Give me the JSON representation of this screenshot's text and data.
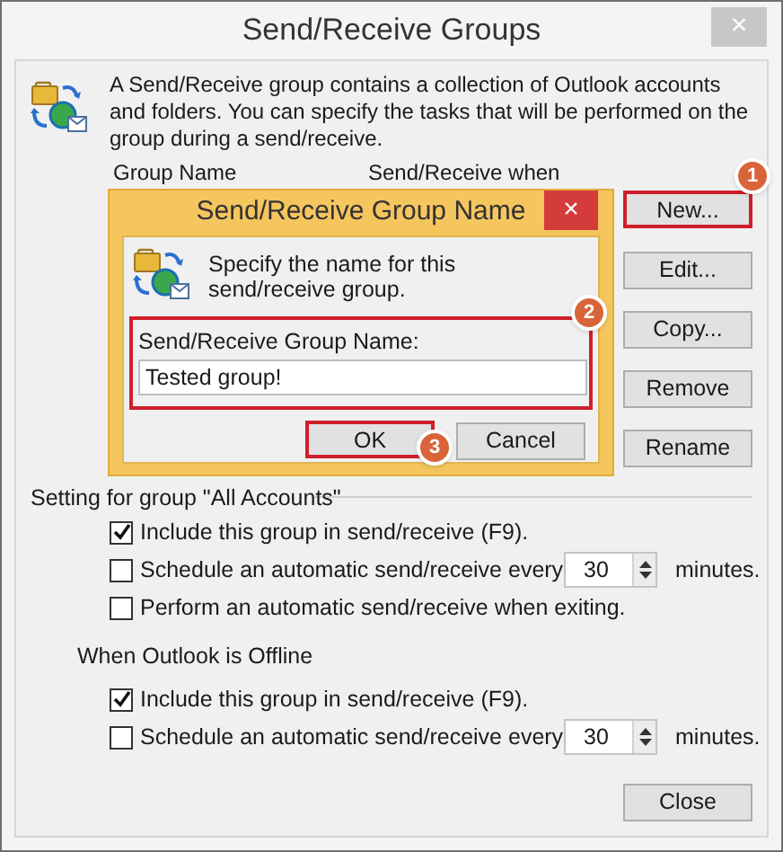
{
  "window": {
    "title": "Send/Receive Groups",
    "close": "×"
  },
  "intro": "A Send/Receive group contains a collection of Outlook accounts and folders. You can specify the tasks that will be performed on the group during a send/receive.",
  "columns": [
    "Group Name",
    "Send/Receive when"
  ],
  "buttons": [
    {
      "label": "New...",
      "highlighted": true,
      "badge": "1"
    },
    {
      "label": "Edit...",
      "highlighted": false
    },
    {
      "label": "Copy...",
      "highlighted": false
    },
    {
      "label": "Remove",
      "highlighted": false
    },
    {
      "label": "Rename",
      "highlighted": false
    }
  ],
  "dialog": {
    "title": "Send/Receive Group Name",
    "close": "×",
    "prompt": "Specify the name for this send/receive group.",
    "field_label": "Send/Receive Group Name:",
    "field_value": "Tested group!",
    "field_highlighted": true,
    "field_badge": "2",
    "buttons": [
      {
        "label": "OK",
        "highlighted": true,
        "badge": "3"
      },
      {
        "label": "Cancel",
        "highlighted": false
      }
    ]
  },
  "settings_label": "Setting for group \"All Accounts\"",
  "online_options": [
    {
      "kind": "checkbox",
      "label": "Include this group in send/receive (F9).",
      "checked": true
    },
    {
      "kind": "schedule",
      "label": "Schedule an automatic send/receive every",
      "checked": false,
      "value": "30",
      "unit": "minutes."
    },
    {
      "kind": "checkbox",
      "label": "Perform an automatic send/receive when exiting.",
      "checked": false
    }
  ],
  "offline_label": "When Outlook is Offline",
  "offline_options": [
    {
      "kind": "checkbox",
      "label": "Include this group in send/receive (F9).",
      "checked": true
    },
    {
      "kind": "schedule",
      "label": "Schedule an automatic send/receive every",
      "checked": false,
      "value": "30",
      "unit": "minutes."
    }
  ],
  "close_button": "Close"
}
